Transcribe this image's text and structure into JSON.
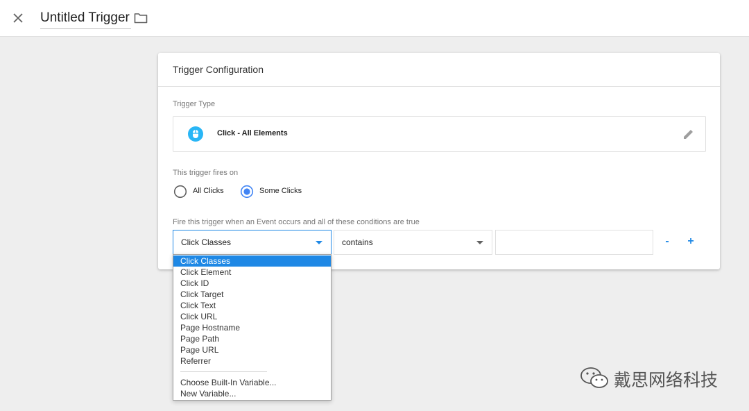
{
  "header": {
    "trigger_name": "Untitled Trigger",
    "close_icon": "close-icon",
    "folder_icon": "folder-icon"
  },
  "card": {
    "title": "Trigger Configuration",
    "trigger_type_label": "Trigger Type",
    "trigger_type_value": "Click - All Elements",
    "trigger_type_icon": "click-icon",
    "fires_on_label": "This trigger fires on",
    "fires_on_options": [
      {
        "label": "All Clicks",
        "selected": false
      },
      {
        "label": "Some Clicks",
        "selected": true
      }
    ],
    "condition_label": "Fire this trigger when an Event occurs and all of these conditions are true",
    "condition": {
      "variable": "Click Classes",
      "operator": "contains",
      "value": ""
    },
    "remove_label": "-",
    "add_label": "+"
  },
  "dropdown": {
    "items": [
      "Click Classes",
      "Click Element",
      "Click ID",
      "Click Target",
      "Click Text",
      "Click URL",
      "Page Hostname",
      "Page Path",
      "Page URL",
      "Referrer"
    ],
    "selected_index": 0,
    "extra_items": [
      "Choose Built-In Variable...",
      "New Variable..."
    ]
  },
  "watermark": {
    "text": "戴思网络科技"
  },
  "colors": {
    "accent": "#1e88e5",
    "radio_active": "#4285f4",
    "icon_blue": "#29b6f6",
    "background": "#eeeeee"
  }
}
